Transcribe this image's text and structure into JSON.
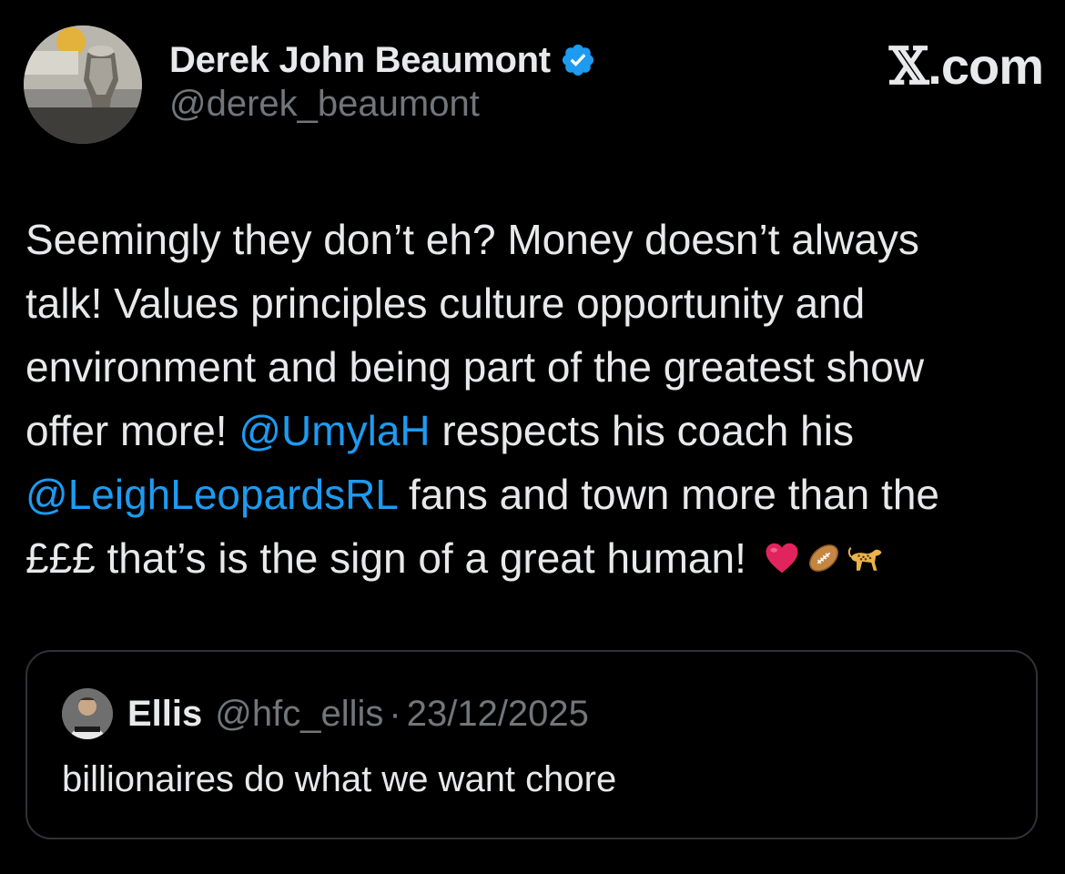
{
  "brand": {
    "x_mark": "𝕏",
    "suffix": ".com"
  },
  "author": {
    "display_name": "Derek John Beaumont",
    "handle": "@derek_beaumont",
    "verified": true,
    "avatar_icon": "avatar-trophy-photo",
    "verified_icon": "verified-badge-icon",
    "verified_color": "#1d9bf0"
  },
  "tweet": {
    "lines": [
      [
        {
          "text": "Seemingly they don’t eh? Money doesn’t always",
          "type": "text"
        }
      ],
      [
        {
          "text": "talk! Values principles culture opportunity and",
          "type": "text"
        }
      ],
      [
        {
          "text": "environment and being part of the greatest show",
          "type": "text"
        }
      ],
      [
        {
          "text": "offer more! ",
          "type": "text"
        },
        {
          "text": "@UmylaH",
          "type": "mention"
        },
        {
          "text": " respects his coach his",
          "type": "text"
        }
      ],
      [
        {
          "text": "@LeighLeopardsRL",
          "type": "mention"
        },
        {
          "text": " fans and town more than the",
          "type": "text"
        }
      ],
      [
        {
          "text": "£££ that’s is the sign of a great human!",
          "type": "text"
        }
      ]
    ],
    "emojis": [
      "heart-icon",
      "rugby-ball-icon",
      "leopard-icon"
    ],
    "mention_color": "#1d9bf0"
  },
  "quote": {
    "name": "Ellis",
    "handle": "@hfc_ellis",
    "separator": "·",
    "date": "23/12/2025",
    "text": "billionaires do what we want chore",
    "avatar_icon": "avatar-photo"
  },
  "colors": {
    "background": "#000000",
    "text": "#e7e9ea",
    "muted": "#71767b",
    "border": "#2f3336"
  }
}
